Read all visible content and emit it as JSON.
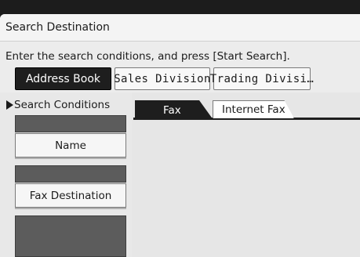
{
  "header": {
    "title": "Search Destination"
  },
  "instruction": "Enter the search conditions, and press [Start Search].",
  "groups": [
    {
      "label": "Address Book",
      "selected": true
    },
    {
      "label": "Sales Division",
      "selected": false
    },
    {
      "label": "Trading Divisi…",
      "selected": false
    }
  ],
  "conditions": {
    "heading": "Search Conditions",
    "name_button": "Name",
    "fax_destination_button": "Fax Destination"
  },
  "tabs": [
    {
      "label": "Fax",
      "active": true
    },
    {
      "label": "Internet Fax",
      "active": false
    }
  ],
  "colors": {
    "selected": "#1e1e1e",
    "panel": "#ececec",
    "field_dark": "#5c5c5c"
  },
  "icons": {
    "conditions_marker": "triangle-right-icon"
  }
}
